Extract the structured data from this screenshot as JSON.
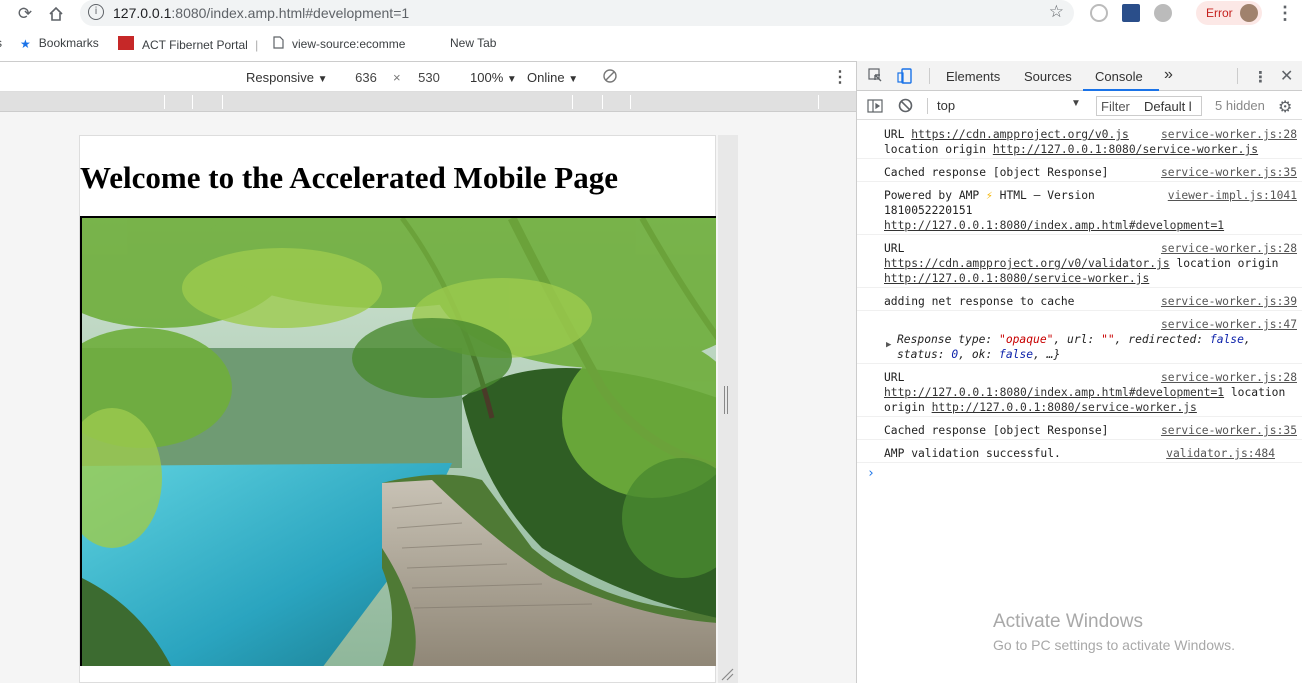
{
  "browser": {
    "url_host": "127.0.0.1",
    "url_rest": ":8080/index.amp.html#development=1",
    "error_label": "Error",
    "bookmarks": [
      {
        "label": "Bookmarks",
        "icon": "star-icon"
      },
      {
        "label": "ACT Fibernet Portal",
        "icon": "act-logo-icon"
      },
      {
        "label": "view-source:ecomme",
        "icon": "page-icon"
      },
      {
        "label": "New Tab",
        "icon": ""
      }
    ],
    "bookmark_separator": "|"
  },
  "device_toolbar": {
    "mode": "Responsive",
    "width": "636",
    "times": "×",
    "height": "530",
    "zoom": "100%",
    "network": "Online"
  },
  "page": {
    "heading": "Welcome to the Accelerated Mobile Page"
  },
  "devtools": {
    "tabs": [
      "Elements",
      "Sources",
      "Console"
    ],
    "active_tab": "Console",
    "more": "»",
    "context": "top",
    "filter_placeholder": "Filter",
    "levels": "Default l",
    "hidden_count": "5 hidden",
    "logs": [
      {
        "src": "service-worker.js:28",
        "parts": [
          "URL ",
          "https://cdn.ampproject.org/v0.js",
          " location origin ",
          "http://127.0.0.1:8080/service-worker.js"
        ]
      },
      {
        "src": "service-worker.js:35",
        "text": "Cached response [object Response]"
      },
      {
        "src": "viewer-impl.js:1041",
        "parts": [
          "Powered by AMP ",
          "⚡",
          " HTML – Version 1810052220151 ",
          "http://127.0.0.1:8080/index.amp.html#development=1"
        ]
      },
      {
        "src": "service-worker.js:28",
        "parts": [
          "URL ",
          "https://cdn.ampproject.org/v0/validator.js",
          " location origin ",
          "http://127.0.0.1:8080/service-worker.js"
        ]
      },
      {
        "src": "service-worker.js:39",
        "text": "adding net response to cache"
      },
      {
        "src": "service-worker.js:47",
        "obj": {
          "head": "Response ",
          "type_key": "type: ",
          "type_val": "\"opaque\"",
          "url_key": ", url: ",
          "url_val": "\"\"",
          "red_key": ", redirected: ",
          "red_val": "false",
          "status_key": ", status: ",
          "status_val": "0",
          "ok_key": ", ok: ",
          "ok_val": "false",
          "tail": ", …}"
        }
      },
      {
        "src": "service-worker.js:28",
        "parts": [
          "URL ",
          "http://127.0.0.1:8080/index.amp.html#development=1",
          " location origin ",
          "http://127.0.0.1:8080/service-worker.js"
        ]
      },
      {
        "src": "service-worker.js:35",
        "text": "Cached response [object Response]"
      },
      {
        "src": "validator.js:484",
        "text": "AMP validation successful."
      }
    ],
    "prompt": "›"
  },
  "watermark": {
    "line1": "Activate Windows",
    "line2": "Go to PC settings to activate Windows."
  }
}
